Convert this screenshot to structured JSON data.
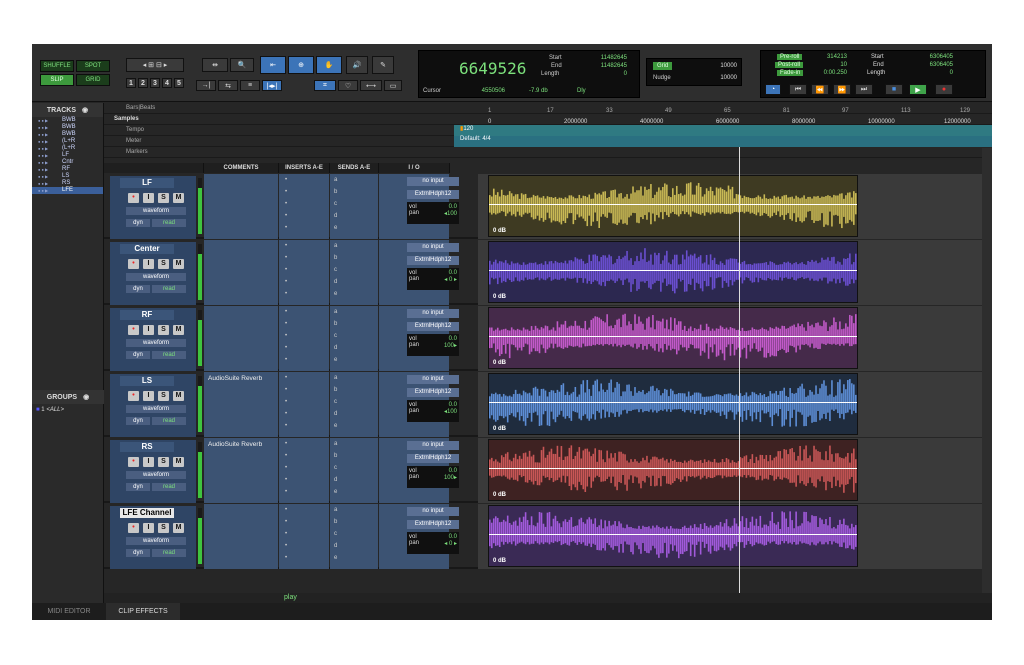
{
  "toolbar": {
    "modes": [
      {
        "label": "SHUFFLE",
        "on": false
      },
      {
        "label": "SPOT",
        "on": false
      },
      {
        "label": "SLIP",
        "on": true
      },
      {
        "label": "GRID",
        "on": false
      }
    ],
    "numbers": [
      "1",
      "2",
      "3",
      "4",
      "5"
    ],
    "main_counter": "6649526",
    "start_label": "Start",
    "start_value": "11482645",
    "end_label": "End",
    "end_value": "11482645",
    "length_label": "Length",
    "length_value": "0",
    "cursor_label": "Cursor",
    "cursor_value": "4550506",
    "cursor_db": "-7.9 db",
    "dly_label": "Dly",
    "grid_label": "Grid",
    "grid_value": "10000",
    "nudge_label": "Nudge",
    "nudge_value": "10000",
    "preroll_label": "Pre-roll",
    "preroll_value": "314213",
    "postroll_label": "Post-roll",
    "postroll_value": "10",
    "fadein_label": "Fade-in",
    "fadein_value": "0:00.250",
    "t_start_label": "Start",
    "t_start_value": "6306405",
    "t_end_label": "End",
    "t_end_value": "6306405",
    "t_length_label": "Length",
    "t_length_value": "0"
  },
  "tracks_panel": {
    "title": "TRACKS",
    "items": [
      "BWB",
      "BWB",
      "BWB",
      "(L+R",
      "(L+R",
      "LF",
      "Cntr",
      "RF",
      "LS",
      "RS",
      "LFE"
    ],
    "selected_index": 10
  },
  "groups_panel": {
    "title": "GROUPS",
    "item_num": "1",
    "item_label": "<ALL>"
  },
  "rulers": {
    "bars_label": "Bars|Beats",
    "samples_label": "Samples",
    "tempo_label": "Tempo",
    "tempo_value": "120",
    "meter_label": "Meter",
    "meter_value": "Default: 4/4",
    "markers_label": "Markers",
    "bar_ticks": [
      "1",
      "17",
      "33",
      "49",
      "65",
      "81",
      "97",
      "113",
      "129"
    ],
    "sample_ticks": [
      "0",
      "2000000",
      "4000000",
      "6000000",
      "8000000",
      "10000000",
      "12000000"
    ]
  },
  "columns": {
    "comments": "COMMENTS",
    "inserts": "INSERTS A-E",
    "sends": "SENDS A-E",
    "io": "I / O"
  },
  "rsm": {
    "r": "•",
    "i": "I",
    "s": "S",
    "m": "M"
  },
  "send_slots": [
    "a",
    "b",
    "c",
    "d",
    "e"
  ],
  "track_common": {
    "waveform": "waveform",
    "dyn": "dyn",
    "read": "read",
    "input": "no input",
    "output": "ExtrnlHdph12",
    "vol_label": "vol",
    "pan_label": "pan",
    "clip_gain": "0 dB"
  },
  "tracks": [
    {
      "name": "LF",
      "comment": "",
      "vol": "0.0",
      "pan": "100",
      "pan_dir": "left",
      "color": "#c9b955",
      "bg": "#3e3a22"
    },
    {
      "name": "Center",
      "comment": "",
      "vol": "0.0",
      "pan": "0",
      "pan_dir": "center",
      "color": "#6a4fd0",
      "bg": "#2c2850"
    },
    {
      "name": "RF",
      "comment": "",
      "vol": "0.0",
      "pan": "100",
      "pan_dir": "right",
      "color": "#c25ac9",
      "bg": "#452a4a"
    },
    {
      "name": "LS",
      "comment": "AudioSuite Reverb",
      "vol": "0.0",
      "pan": "100",
      "pan_dir": "left",
      "color": "#5d8ed6",
      "bg": "#1f2c3e"
    },
    {
      "name": "RS",
      "comment": "AudioSuite Reverb",
      "vol": "0.0",
      "pan": "100",
      "pan_dir": "right",
      "color": "#c85656",
      "bg": "#3e2222"
    },
    {
      "name": "LFE Channel",
      "comment": "",
      "vol": "0.0",
      "pan": "0",
      "pan_dir": "center",
      "color": "#a15adb",
      "bg": "#3a2a55"
    }
  ],
  "status": {
    "play": "play"
  },
  "tabs": [
    "MIDI EDITOR",
    "CLIP EFFECTS"
  ]
}
